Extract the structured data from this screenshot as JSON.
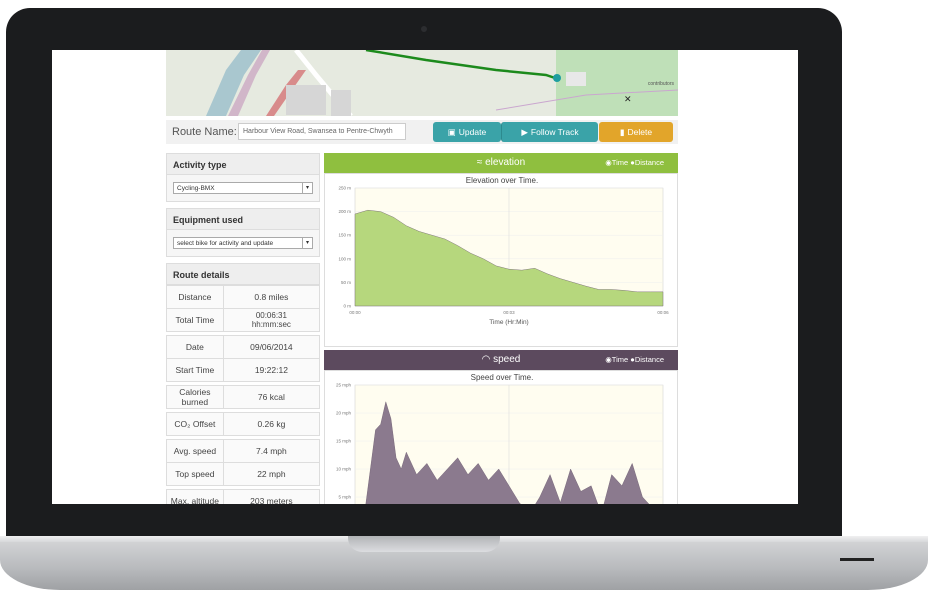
{
  "route": {
    "label": "Route Name:",
    "value": "Harbour View Road, Swansea to Pentre-Chwyth",
    "update": "Update",
    "follow": "Follow Track",
    "delete": "Delete"
  },
  "map": {
    "attribution": "contributors"
  },
  "activity": {
    "title": "Activity type",
    "value": "Cycling-BMX"
  },
  "equipment": {
    "title": "Equipment used",
    "value": "select bike for activity and update"
  },
  "details": {
    "title": "Route details",
    "rows": [
      {
        "label": "Distance",
        "value": "0.8 miles"
      },
      {
        "label": "Total Time",
        "value": "00:06:31 hh:mm:sec"
      },
      {
        "label": "Date",
        "value": "09/06/2014"
      },
      {
        "label": "Start Time",
        "value": "19:22:12"
      },
      {
        "label": "Calories burned",
        "value": "76 kcal"
      },
      {
        "label": "CO₂ Offset",
        "value": "0.26 kg"
      },
      {
        "label": "Avg. speed",
        "value": "7.4 mph"
      },
      {
        "label": "Top speed",
        "value": "22 mph"
      },
      {
        "label": "Max. altitude",
        "value": "203 meters"
      }
    ]
  },
  "elevation_panel": {
    "heading": "elevation",
    "toggle_time": "Time",
    "toggle_distance": "Distance",
    "accent": "#8fbf3f"
  },
  "speed_panel": {
    "heading": "speed",
    "toggle_time": "Time",
    "toggle_distance": "Distance",
    "accent": "#5c4a5e"
  },
  "chart_data": [
    {
      "type": "area",
      "title": "Elevation over Time.",
      "xlabel": "Time (Hr:Min)",
      "ylabel": "",
      "x_ticks": [
        "00:00",
        "00:03",
        "00:06"
      ],
      "y_ticks": [
        "0 m",
        "50 m",
        "100 m",
        "150 m",
        "200 m",
        "250 m"
      ],
      "ylim": [
        0,
        250
      ],
      "x": [
        0,
        0.25,
        0.5,
        0.75,
        1,
        1.25,
        1.5,
        1.75,
        2,
        2.25,
        2.5,
        2.75,
        3,
        3.25,
        3.5,
        3.75,
        4,
        4.25,
        4.5,
        4.75,
        5,
        5.25,
        5.5,
        5.75,
        6
      ],
      "values": [
        195,
        203,
        200,
        188,
        170,
        158,
        150,
        142,
        128,
        112,
        100,
        85,
        78,
        76,
        80,
        68,
        58,
        50,
        42,
        35,
        35,
        33,
        30,
        30,
        30
      ],
      "color": "#b6d77d"
    },
    {
      "type": "area",
      "title": "Speed over Time.",
      "xlabel": "",
      "ylabel": "",
      "y_ticks": [
        "5 mph",
        "10 mph",
        "15 mph",
        "20 mph",
        "25 mph"
      ],
      "ylim": [
        0,
        25
      ],
      "x": [
        0,
        0.2,
        0.4,
        0.5,
        0.6,
        0.7,
        0.8,
        0.9,
        1.0,
        1.2,
        1.4,
        1.6,
        1.8,
        2.0,
        2.2,
        2.4,
        2.6,
        2.8,
        3.0,
        3.2,
        3.4,
        3.6,
        3.8,
        4.0,
        4.2,
        4.4,
        4.6,
        4.8,
        5.0,
        5.2,
        5.4,
        5.6,
        5.8,
        6.0
      ],
      "values": [
        0,
        3,
        17,
        18,
        22,
        19,
        12,
        10,
        13,
        9,
        11,
        8,
        10,
        12,
        9,
        11,
        8,
        10,
        7,
        4,
        2,
        5,
        9,
        4,
        10,
        6,
        7,
        2,
        9,
        7,
        11,
        5,
        3,
        2
      ],
      "color": "#8b7a8e"
    }
  ]
}
